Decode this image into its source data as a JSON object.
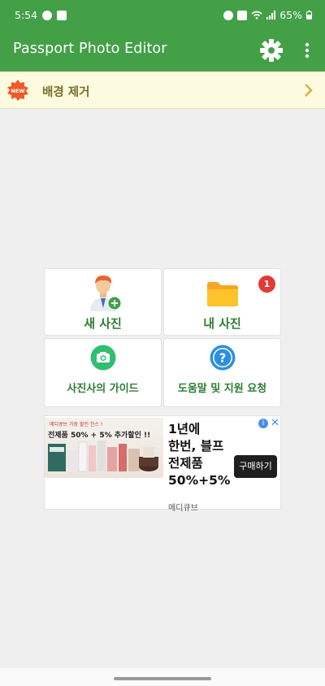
{
  "status_bar": {
    "time": "5:54",
    "battery": "65%"
  },
  "app_bar": {
    "title": "Passport Photo Editor",
    "settings_icon": "gear-icon",
    "menu_icon": "more-vert-icon"
  },
  "banner": {
    "badge_text": "NEW",
    "label": "배경 제거",
    "chevron_icon": "chevron-right-icon"
  },
  "menu": {
    "new_photo": {
      "label": "새 사진",
      "icon": "add-person-icon"
    },
    "my_photos": {
      "label": "내 사진",
      "icon": "folder-icon",
      "count": "1"
    },
    "guide": {
      "label": "사진사의 가이드",
      "icon": "camera-icon"
    },
    "help": {
      "label": "도움말 및 지원 요청",
      "icon": "help-icon"
    }
  },
  "ad": {
    "caption": "메디큐브 가장 할인 찬스 !",
    "promo": "전제품 50% + 5% 추가할인 !!",
    "title": "1년에\n한번, 블프\n전제품\n50%+5%",
    "button": "구매하기",
    "advertiser": "메디큐브",
    "info": "i",
    "close": "✕"
  },
  "colors": {
    "primary": "#43a047",
    "accent_text": "#2e7d32",
    "badge": "#e53935",
    "banner_bg": "#fdfbdf"
  }
}
